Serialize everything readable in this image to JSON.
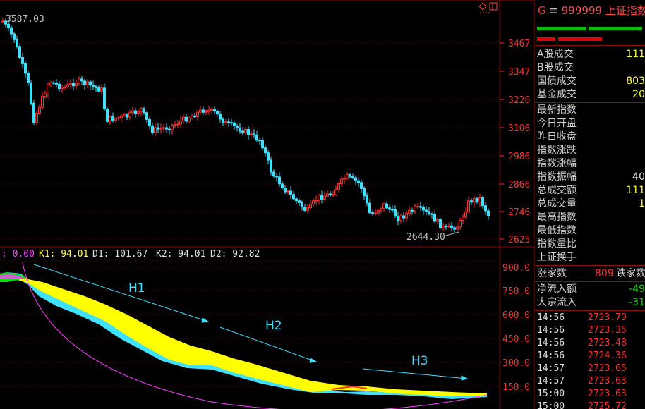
{
  "price_chart": {
    "high_label": "3587.03",
    "low_label": "2644.30",
    "y_ticks": [
      "3467",
      "3347",
      "3226",
      "3106",
      "2986",
      "2866",
      "2746",
      "2625"
    ],
    "corner_icons": [
      "diamond-icon",
      "window-icon"
    ]
  },
  "indicator": {
    "legend": {
      "prefix": ": 0.00",
      "k1": "K1: 94.01",
      "d1": "D1: 101.67",
      "k2": "K2: 94.01",
      "d2": "D2: 92.82"
    },
    "y_ticks": [
      "900.0",
      "750.0",
      "600.0",
      "450.0",
      "300.0",
      "150.0"
    ],
    "annotations": [
      "H1",
      "H2",
      "H3"
    ]
  },
  "sidebar": {
    "header": {
      "g": "G",
      "menu": "≡",
      "code": "999999",
      "name": "上证指数"
    },
    "volume_rows": [
      {
        "label": "A股成交",
        "value": "111"
      },
      {
        "label": "B股成交",
        "value": ""
      },
      {
        "label": "国债成交",
        "value": "803"
      },
      {
        "label": "基金成交",
        "value": "20"
      }
    ],
    "index_rows": [
      {
        "label": "最新指数",
        "value": ""
      },
      {
        "label": "今日开盘",
        "value": ""
      },
      {
        "label": "昨日收盘",
        "value": ""
      },
      {
        "label": "指数涨跌",
        "value": ""
      },
      {
        "label": "指数涨幅",
        "value": ""
      },
      {
        "label": "指数振幅",
        "value": "40"
      },
      {
        "label": "总成交额",
        "value": "111"
      },
      {
        "label": "总成交量",
        "value": "1"
      },
      {
        "label": "最高指数",
        "value": ""
      },
      {
        "label": "最低指数",
        "value": ""
      },
      {
        "label": "指数量比",
        "value": ""
      },
      {
        "label": "上证换手",
        "value": ""
      }
    ],
    "breadth": {
      "up_label": "涨家数",
      "up_value": "809",
      "down_label": "跌家数"
    },
    "flows": [
      {
        "label": "净流入额",
        "value": "-49"
      },
      {
        "label": "大宗流入",
        "value": "-31"
      }
    ],
    "ticks": [
      {
        "time": "14:56",
        "price": "2723.79"
      },
      {
        "time": "14:56",
        "price": "2723.35"
      },
      {
        "time": "14:56",
        "price": "2723.48"
      },
      {
        "time": "14:56",
        "price": "2724.36"
      },
      {
        "time": "14:57",
        "price": "2723.65"
      },
      {
        "time": "14:57",
        "price": "2723.63"
      },
      {
        "time": "15:00",
        "price": "2723.63"
      },
      {
        "time": "15:00",
        "price": "2725.72"
      }
    ]
  },
  "colors": {
    "up": "#ff3030",
    "down": "#40e0ff",
    "band": "#ffff00",
    "axis": "#a00000",
    "curve": "#ff40ff"
  }
}
